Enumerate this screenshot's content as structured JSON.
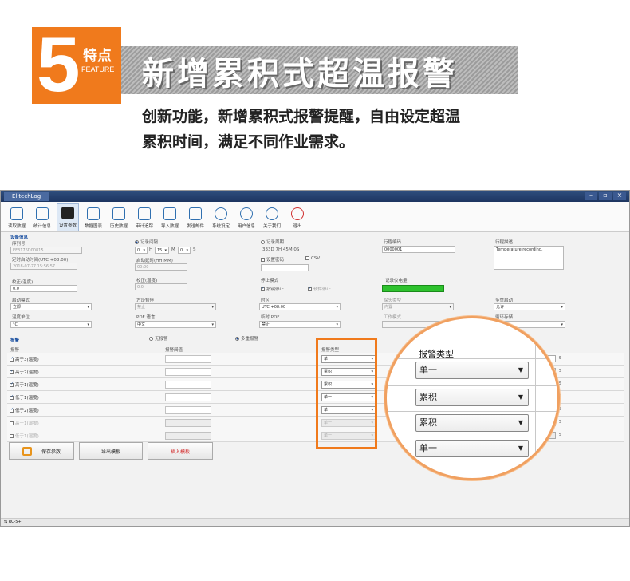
{
  "banner": {
    "number": "5",
    "label_cn": "特点",
    "label_en": "FEATURE",
    "headline": "新增累积式超温报警",
    "desc_line1": "创新功能，新增累积式报警提醒，自由设定超温",
    "desc_line2": "累积时间，满足不同作业需求。"
  },
  "window": {
    "title": "ElitechLog",
    "controls": [
      "–",
      "▫",
      "×"
    ]
  },
  "toolbar": [
    {
      "label": "读取数据",
      "icon": "download-icon"
    },
    {
      "label": "统计信息",
      "icon": "stats-icon"
    },
    {
      "label": "设置参数",
      "icon": "tools-icon"
    },
    {
      "label": "数据图表",
      "icon": "chart-icon"
    },
    {
      "label": "历史数据",
      "icon": "history-icon"
    },
    {
      "label": "审计追踪",
      "icon": "audit-icon"
    },
    {
      "label": "导入数据",
      "icon": "import-icon"
    },
    {
      "label": "发送邮件",
      "icon": "mail-icon"
    },
    {
      "label": "系统设定",
      "icon": "gear-icon"
    },
    {
      "label": "用户信息",
      "icon": "user-icon"
    },
    {
      "label": "关于我们",
      "icon": "info-icon"
    },
    {
      "label": "退出",
      "icon": "power-icon"
    }
  ],
  "device": {
    "section": "设备信息",
    "serial_label": "序列号",
    "serial_value": "EF3176D00815",
    "clock_label": "定时启动时间(UTC +08:00)",
    "clock_value": "2018-07-27 15:56:57",
    "calib_label": "校正(温度)",
    "calib_value": "0.0",
    "start_mode_label": "启动模式",
    "start_mode_value": "立即",
    "unit_label": "温度单位",
    "unit_value": "°C",
    "interval_radio": "记录间隔",
    "interval_h": "0",
    "interval_h_unit": "H",
    "interval_m": "15",
    "interval_m_unit": "M",
    "interval_s": "0",
    "interval_s_unit": "S",
    "delay_label": "启动延时(HH:MM)",
    "delay_value": "00:00",
    "calib2_label": "校正(湿度)",
    "calib2_value": "0.0",
    "pause_label": "方设暂停",
    "pause_value": "禁止",
    "pdf_lang_label": "PDF 语言",
    "pdf_lang_value": "中文",
    "period_radio": "记录周期",
    "period_value": "333D 7H 45M 0S",
    "pwd_label": "设置密码",
    "csv_label": "CSV",
    "stop_mode_label": "停止模式",
    "stop_key_label": "按键停止",
    "stop_soft_label": "软件停止",
    "tz_label": "时区",
    "tz_value": "UTC +08:00",
    "temp_pdf_label": "临时 PDF",
    "temp_pdf_value": "禁止",
    "trip_label": "行程编码",
    "trip_value": "0000001",
    "battery_label": "记录仪电量",
    "probe_label": "探头类型",
    "probe_value": "内置",
    "work_mode_label": "工作模式",
    "trip_desc_label": "行程描述",
    "trip_desc_value": "Temperature recording.",
    "multi_start_label": "多重启动",
    "multi_start_value": "允许",
    "loop_label": "循环存储",
    "loop_value": "禁止"
  },
  "alarm": {
    "section": "报警",
    "no_alarm": "无报警",
    "multi_alarm": "多重报警",
    "col_alarm": "报警",
    "col_threshold": "报警阀值",
    "col_type": "报警类型",
    "rows": [
      {
        "label": "高于3(温度)",
        "checked": true,
        "type": "单一",
        "enabled": true
      },
      {
        "label": "高于2(温度)",
        "checked": true,
        "type": "累积",
        "enabled": true
      },
      {
        "label": "高于1(温度)",
        "checked": true,
        "type": "累积",
        "enabled": true
      },
      {
        "label": "低于1(温度)",
        "checked": true,
        "type": "单一",
        "enabled": true
      },
      {
        "label": "低于2(温度)",
        "checked": true,
        "type": "单一",
        "enabled": true
      },
      {
        "label": "高于1(湿度)",
        "checked": false,
        "type": "单一",
        "enabled": false
      },
      {
        "label": "低于1(湿度)",
        "checked": false,
        "type": "单一",
        "enabled": false
      }
    ],
    "right_col_values": [
      "M",
      "0",
      "S"
    ]
  },
  "buttons": {
    "save": "保存参数",
    "export": "导出模板",
    "import": "插入模板"
  },
  "status": "RC-5+",
  "lens": {
    "title": "报警类型",
    "options": [
      "单一",
      "累积",
      "累积",
      "单一"
    ]
  },
  "colors": {
    "accent": "#f07a1c",
    "battery": "#2ec22e",
    "title_bar": "#1d3560"
  }
}
